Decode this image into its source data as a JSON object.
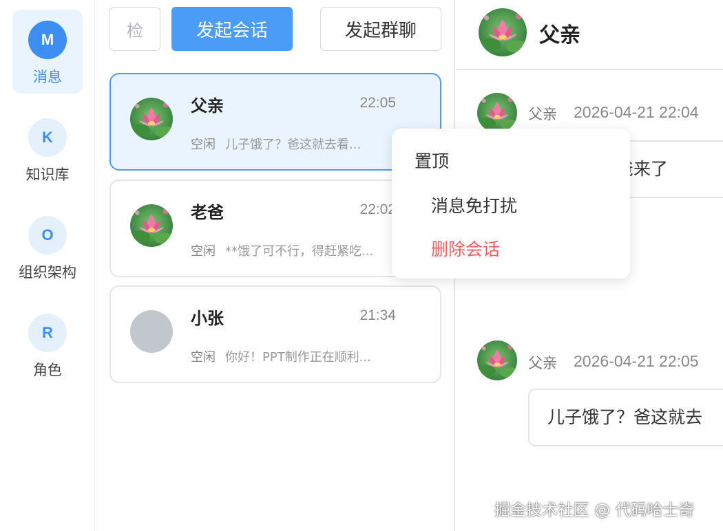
{
  "sidebar": {
    "items": [
      {
        "letter": "M",
        "label": "消息"
      },
      {
        "letter": "K",
        "label": "知识库"
      },
      {
        "letter": "O",
        "label": "组织架构"
      },
      {
        "letter": "R",
        "label": "角色"
      }
    ]
  },
  "toolbar": {
    "search_text": "检",
    "start_chat": "发起会话",
    "start_group": "发起群聊"
  },
  "conversations": [
    {
      "name": "父亲",
      "time": "22:05",
      "status": "空闲",
      "preview": "儿子饿了？爸这就去看..."
    },
    {
      "name": "老爸",
      "time": "22:02",
      "status": "空闲",
      "preview": "**饿了可不行，得赶紧吃..."
    },
    {
      "name": "小张",
      "time": "21:34",
      "status": "空闲",
      "preview": "你好！PPT制作正在顺利..."
    }
  ],
  "chat": {
    "title": "父亲",
    "messages": [
      {
        "sender": "父亲",
        "time": "2026-04-21 22:04",
        "text": "儿子，老爸来了"
      },
      {
        "sender": "父亲",
        "time": "2026-04-21 22:05",
        "text": "儿子饿了？爸这就去"
      }
    ]
  },
  "context_menu": {
    "pin": "置顶",
    "mute": "消息免打扰",
    "delete": "删除会话"
  },
  "watermark": "掘金技术社区 @ 代码哈士奇",
  "colors": {
    "accent": "#4a9cf6",
    "danger": "#ef6060",
    "active_bg": "#eaf4fe"
  }
}
